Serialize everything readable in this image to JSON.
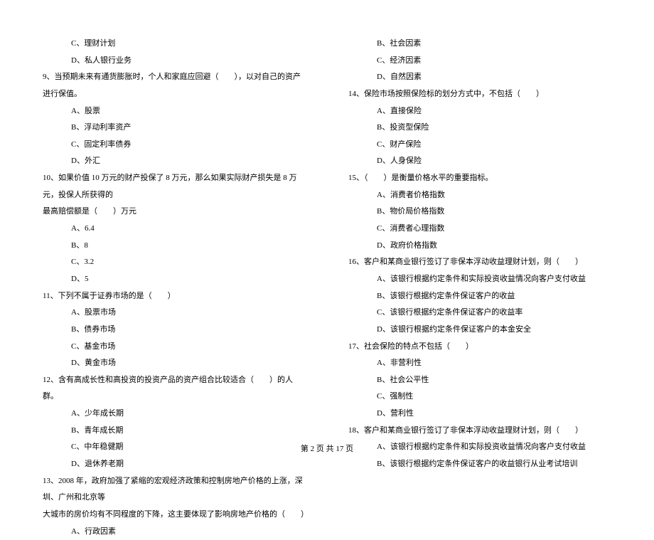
{
  "left": {
    "q8_opt_c": "C、理财计划",
    "q8_opt_d": "D、私人银行业务",
    "q9_stem": "9、当预期未来有通货膨胀时，个人和家庭应回避（　　），以对自己的资产进行保值。",
    "q9_opt_a": "A、股票",
    "q9_opt_b": "B、浮动利率资产",
    "q9_opt_c": "C、固定利率债券",
    "q9_opt_d": "D、外汇",
    "q10_stem_l1": "10、如果价值 10 万元的财产投保了 8 万元，那么如果实际财产损失是 8 万元，投保人所获得的",
    "q10_stem_l2": "最高赔偿额是（　　）万元",
    "q10_opt_a": "A、6.4",
    "q10_opt_b": "B、8",
    "q10_opt_c": "C、3.2",
    "q10_opt_d": "D、5",
    "q11_stem": "11、下列不属于证券市场的是（　　）",
    "q11_opt_a": "A、股票市场",
    "q11_opt_b": "B、债券市场",
    "q11_opt_c": "C、基金市场",
    "q11_opt_d": "D、黄金市场",
    "q12_stem": "12、含有高成长性和高投资的投资产品的资产组合比较适合（　　）的人群。",
    "q12_opt_a": "A、少年成长期",
    "q12_opt_b": "B、青年成长期",
    "q12_opt_c": "C、中年稳健期",
    "q12_opt_d": "D、退休养老期",
    "q13_stem_l1": "13、2008 年，政府加强了紧缩的宏观经济政策和控制房地产价格的上涨，深圳、广州和北京等",
    "q13_stem_l2": "大城市的房价均有不同程度的下降，这主要体现了影响房地产价格的（　　）",
    "q13_opt_a": "A、行政因素"
  },
  "right": {
    "q13_opt_b": "B、社会因素",
    "q13_opt_c": "C、经济因素",
    "q13_opt_d": "D、自然因素",
    "q14_stem": "14、保险市场按照保险标的划分方式中，不包括（　　）",
    "q14_opt_a": "A、直接保险",
    "q14_opt_b": "B、投资型保险",
    "q14_opt_c": "C、财产保险",
    "q14_opt_d": "D、人身保险",
    "q15_stem": "15、（　　）是衡量价格水平的重要指标。",
    "q15_opt_a": "A、消费者价格指数",
    "q15_opt_b": "B、物价局价格指数",
    "q15_opt_c": "C、消费者心理指数",
    "q15_opt_d": "D、政府价格指数",
    "q16_stem": "16、客户和某商业银行签订了非保本浮动收益理财计划，则（　　）",
    "q16_opt_a": "A、该银行根据约定条件和实际投资收益情况向客户支付收益",
    "q16_opt_b": "B、该银行根据约定条件保证客户的收益",
    "q16_opt_c": "C、该银行根据约定条件保证客户的收益率",
    "q16_opt_d": "D、该银行根据约定条件保证客户的本金安全",
    "q17_stem": "17、社会保险的特点不包括（　　）",
    "q17_opt_a": "A、非营利性",
    "q17_opt_b": "B、社会公平性",
    "q17_opt_c": "C、强制性",
    "q17_opt_d": "D、营利性",
    "q18_stem": "18、客户和某商业银行签订了非保本浮动收益理财计划，则（　　）",
    "q18_opt_a": "A、该银行根据约定条件和实际投资收益情况向客户支付收益",
    "q18_opt_b": "B、该银行根据约定条件保证客户的收益银行从业考试培训"
  },
  "footer": "第 2 页 共 17 页"
}
